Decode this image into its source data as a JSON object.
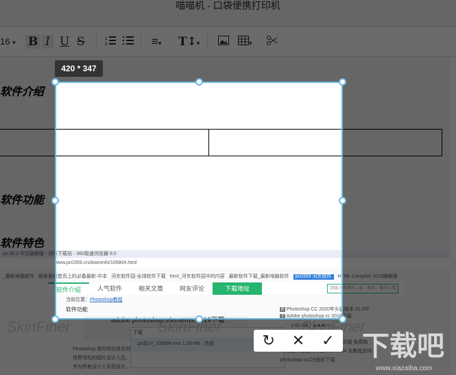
{
  "window": {
    "title": "喵喵机 - 口袋便携打印机"
  },
  "toolbar": {
    "font_size": "16",
    "bold": "B",
    "italic": "I",
    "underline": "U",
    "strike": "S",
    "align": "≡",
    "text_height": "T↕",
    "caret": "▾"
  },
  "editor": {
    "headings": [
      "软件介绍",
      "软件功能",
      "软件特色"
    ]
  },
  "embedded": {
    "browser_title": "ps 20.0 中文破解版 - 河东下载站 - 360极速浏览器 9.0",
    "url": "www.pc0359.cn/downinfo/105804.html",
    "tabs": [
      "_最新电脑软件",
      "我亲爱的首页上的必备最新-中本",
      "河东软件园-全球软件下载",
      "html_河东软件园中的内容",
      "最新软件下载_最新电脑软件",
      "pc0359 河东软件",
      "HTML Compiler 2019破解版"
    ],
    "nav": [
      "软件介绍",
      "人气软件",
      "相关文章",
      "网友评论",
      "下载地址"
    ],
    "search_placeholder": "请输入关键词，如：微信，聊天应用",
    "breadcrumb_label": "当前位置：",
    "breadcrumb": "Photoshop教程",
    "section": "软件功能",
    "product": "adobe photoshop elements 2019下载",
    "list": [
      "Photoshop CC 2020年头猛版本 21.0中",
      "Adobe photoshop cc 2019下载",
      "3.65 GB / ★★★☆☆",
      "Adobe photoshop10.0 官方中文版 免费版",
      "PS顶级人像模特神器DR3+DR4 全教程支持",
      "photoshop cs2注册机下载"
    ],
    "list_nums": [
      "6",
      "7"
    ],
    "paras": [
      "Photoshop 是你的创意实现器。",
      "世界领先的图片设计人员，摄影师和",
      "专为所有设计人员而设计。"
    ],
    "dialog_title": "下载",
    "file_name": "ps@14_105804.exe",
    "file_size": "1.33 MB · 完成",
    "watermark": "SkinFiner",
    "brand": "下载吧",
    "brand_url": "www.xiazaiba.com"
  },
  "selection": {
    "size_label": "420 * 347"
  },
  "actions": {
    "rotate": "↻",
    "cancel": "✕",
    "confirm": "✓"
  },
  "colors": {
    "accent": "#6ab8e0",
    "green": "#27b36e"
  }
}
